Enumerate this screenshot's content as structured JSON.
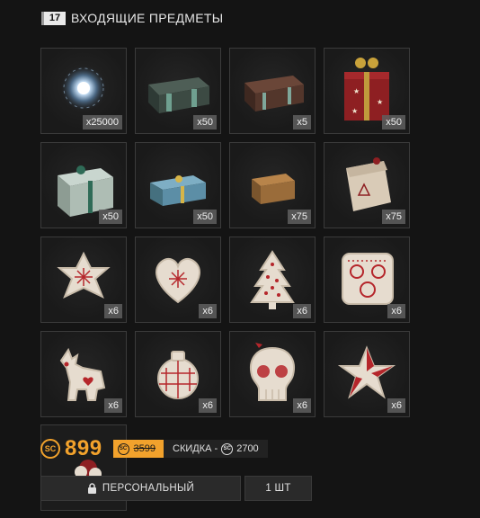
{
  "header": {
    "count": "17",
    "title": "ВХОДЯЩИЕ ПРЕДМЕТЫ"
  },
  "items": [
    {
      "name": "energy-orb",
      "qty": "x25000"
    },
    {
      "name": "green-crate",
      "qty": "x50"
    },
    {
      "name": "brown-crate",
      "qty": "x5"
    },
    {
      "name": "red-gift-box",
      "qty": "x50"
    },
    {
      "name": "green-gift-box",
      "qty": "x50"
    },
    {
      "name": "blue-gift-box",
      "qty": "x50"
    },
    {
      "name": "cardboard-box",
      "qty": "x75"
    },
    {
      "name": "paper-bag",
      "qty": "x75"
    },
    {
      "name": "star-cookie",
      "qty": "x6"
    },
    {
      "name": "heart-cookie",
      "qty": "x6"
    },
    {
      "name": "tree-cookie",
      "qty": "x6"
    },
    {
      "name": "mask-cookie",
      "qty": "x6"
    },
    {
      "name": "deer-cookie",
      "qty": "x6"
    },
    {
      "name": "grenade-cookie",
      "qty": "x6"
    },
    {
      "name": "skull-cookie",
      "qty": "x6"
    },
    {
      "name": "star-red-cookie",
      "qty": "x6"
    }
  ],
  "price": {
    "currency": "SC",
    "current": "899",
    "old": "3599",
    "discount_label": "СКИДКА -",
    "discount_value": "2700"
  },
  "buttons": {
    "personal": "ПЕРСОНАЛЬНЫЙ",
    "quantity": "1 ШТ"
  },
  "colors": {
    "accent": "#f2a22c",
    "background": "#141414",
    "cell_border": "#3b3b3b"
  }
}
